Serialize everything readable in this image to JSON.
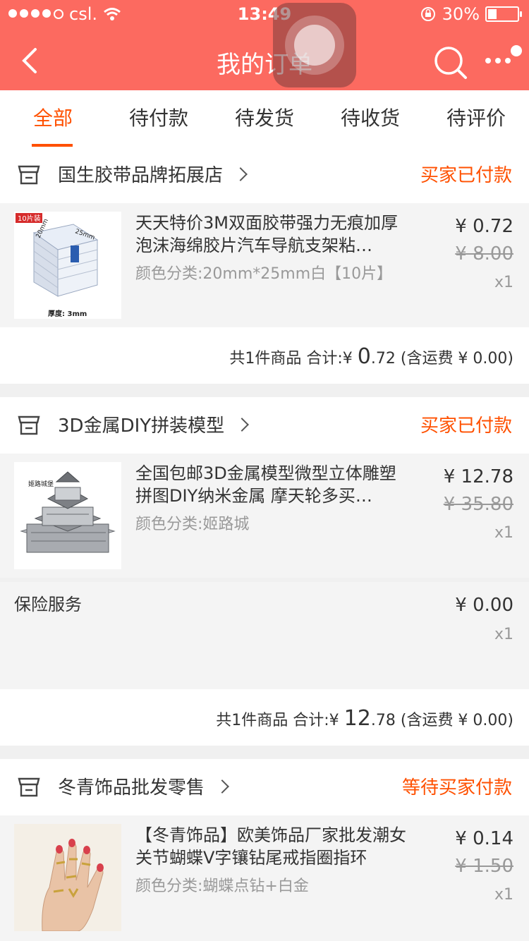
{
  "status_bar": {
    "carrier": "csl.",
    "time": "13:49",
    "battery": "30%",
    "battery_level": 0.3
  },
  "nav": {
    "title": "我的订单"
  },
  "tabs": [
    {
      "label": "全部",
      "active": true
    },
    {
      "label": "待付款",
      "active": false
    },
    {
      "label": "待发货",
      "active": false
    },
    {
      "label": "待收货",
      "active": false
    },
    {
      "label": "待评价",
      "active": false
    }
  ],
  "orders": [
    {
      "shop": "国生胶带品牌拓展店",
      "status": "买家已付款",
      "item": {
        "title": "天天特价3M双面胶带强力无痕加厚泡沫海绵胶片汽车导航支架粘…",
        "sku": "颜色分类:20mm*25mm白【10片】",
        "price": "¥ 0.72",
        "orig_price": "¥ 8.00",
        "qty": "x1",
        "thumb_badge": "10片装",
        "thumb_dim1": "20mm",
        "thumb_dim2": "25mm",
        "thumb_caption": "厚度: 3mm"
      },
      "summary": {
        "count": "共1件商品",
        "total_label": "合计:",
        "currency": "¥",
        "int": "0",
        "dec": ".72",
        "shipping": "(含运费 ¥ 0.00)"
      }
    },
    {
      "shop": "3D金属DIY拼装模型",
      "status": "买家已付款",
      "item": {
        "title": "全国包邮3D金属模型微型立体雕塑拼图DIY纳米金属 摩天轮多买…",
        "sku": "颜色分类:姬路城",
        "price": "¥ 12.78",
        "orig_price": "¥ 35.80",
        "qty": "x1",
        "thumb_caption": "姬路城堡"
      },
      "insurance": {
        "label": "保险服务",
        "price": "¥ 0.00",
        "qty": "x1"
      },
      "summary": {
        "count": "共1件商品",
        "total_label": "合计:",
        "currency": "¥",
        "int": "12",
        "dec": ".78",
        "shipping": "(含运费 ¥ 0.00)"
      }
    },
    {
      "shop": "冬青饰品批发零售",
      "status": "等待买家付款",
      "item": {
        "title": "【冬青饰品】欧美饰品厂家批发潮女关节蝴蝶V字镶钻尾戒指圈指环",
        "sku": "颜色分类:蝴蝶点钻+白金",
        "price": "¥ 0.14",
        "orig_price": "¥ 1.50",
        "qty": "x1"
      }
    }
  ],
  "colors": {
    "header": "#fc6a60",
    "accent": "#ff5000"
  },
  "icons": [
    "back-icon",
    "search-icon",
    "more-icon",
    "shop-icon",
    "chevron-right-icon",
    "wifi-icon",
    "rotation-lock-icon"
  ]
}
